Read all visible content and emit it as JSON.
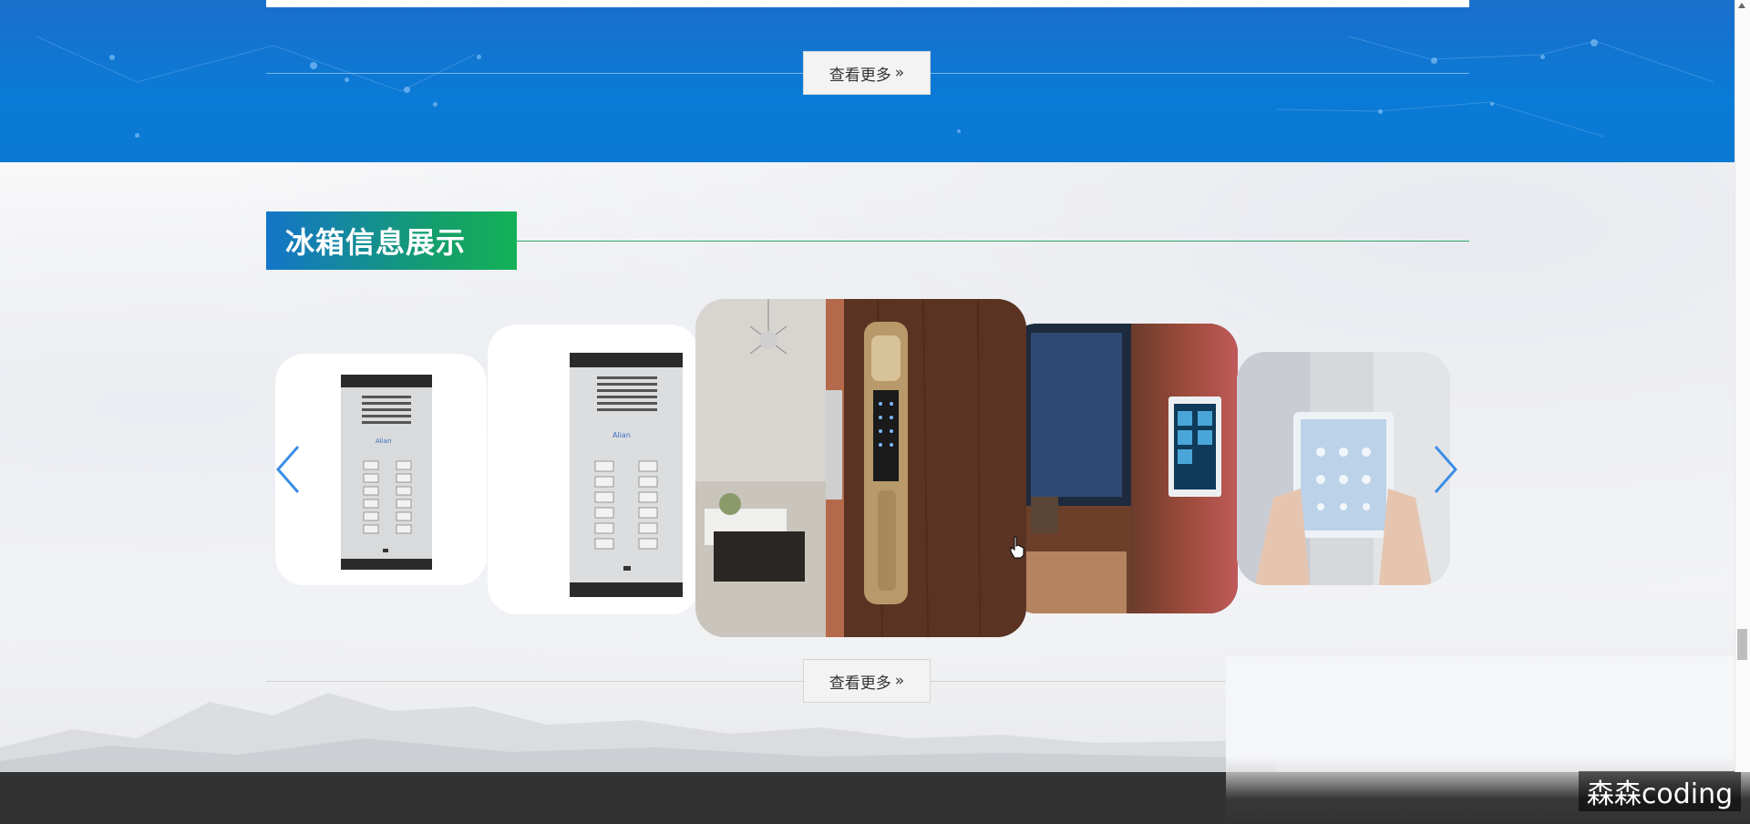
{
  "top_section": {
    "more_button": {
      "label": "查看更多",
      "chevron": "»"
    }
  },
  "showcase": {
    "title": "冰箱信息展示",
    "more_button": {
      "label": "查看更多",
      "chevron": "»"
    },
    "carousel": {
      "prev_icon": "chevron-left-icon",
      "next_icon": "chevron-right-icon",
      "slides": [
        {
          "name": "door-intercom-panel-small",
          "image": "door intercom panel"
        },
        {
          "name": "door-intercom-panel",
          "image": "door intercom panel"
        },
        {
          "name": "smart-door-lock",
          "image": "smart fingerprint door lock"
        },
        {
          "name": "smart-wall-panel",
          "image": "smart home wall control panel"
        },
        {
          "name": "smart-tablet-control",
          "image": "hands holding smart home tablet"
        }
      ]
    }
  },
  "watermark": "森森coding",
  "colors": {
    "band_blue": "#0a7bd6",
    "title_gradient_start": "#1475c9",
    "title_gradient_end": "#13b157",
    "footer": "#323232",
    "arrow_blue": "#3a8ee6"
  }
}
